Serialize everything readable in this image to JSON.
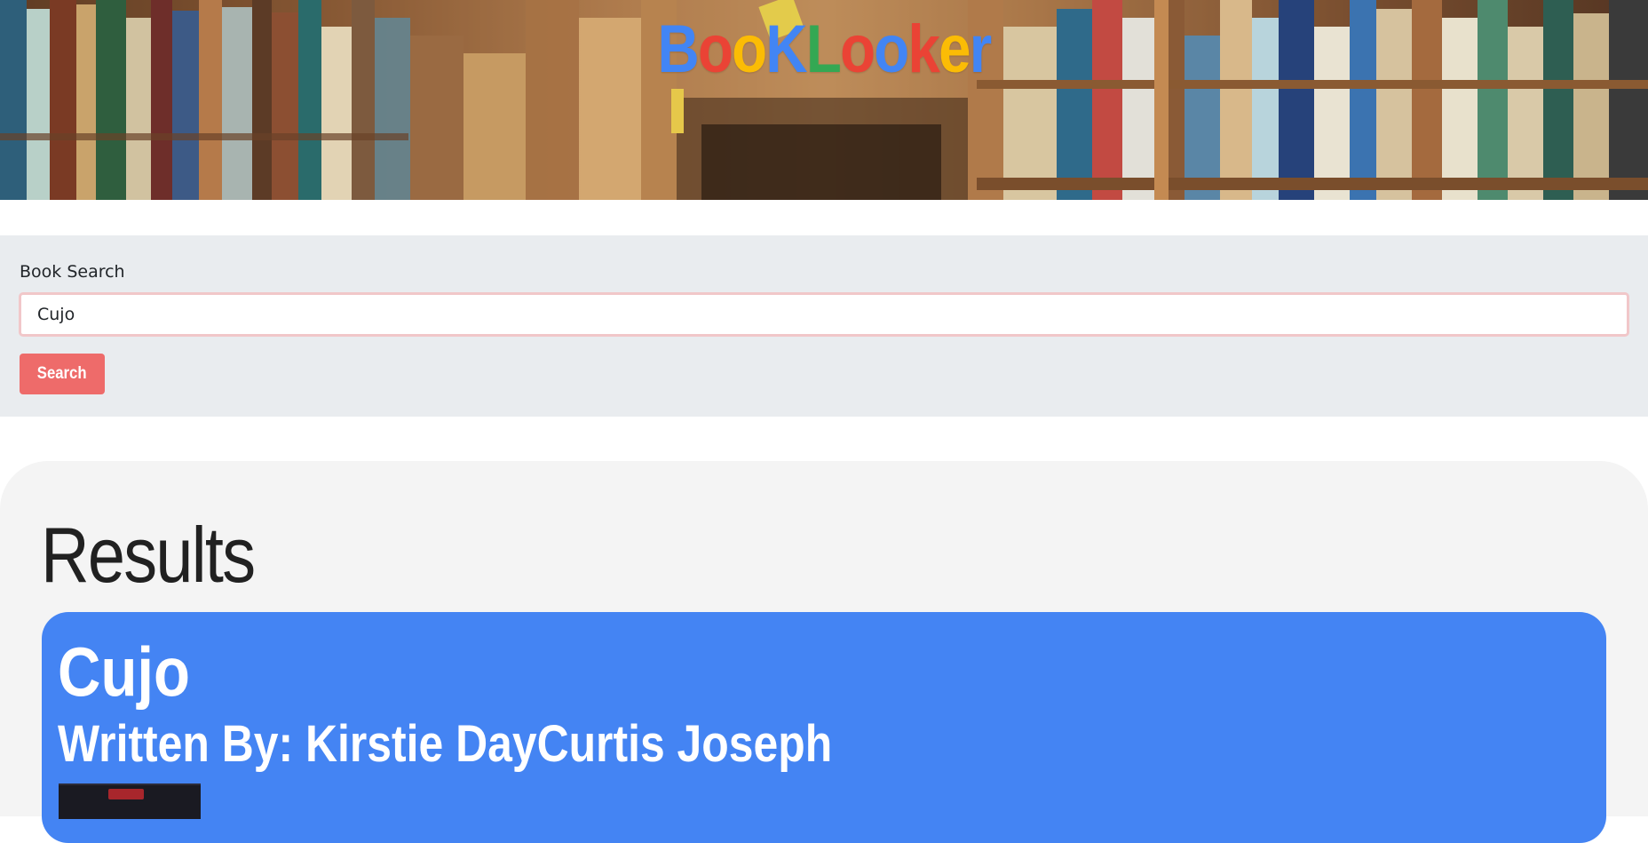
{
  "header": {
    "logo_letters": [
      {
        "char": "B",
        "color": "#4285f4"
      },
      {
        "char": "o",
        "color": "#ea4335"
      },
      {
        "char": "o",
        "color": "#fbbc05"
      },
      {
        "char": "K",
        "color": "#4285f4"
      },
      {
        "char": "L",
        "color": "#34a853"
      },
      {
        "char": "o",
        "color": "#ea4335"
      },
      {
        "char": "o",
        "color": "#4285f4"
      },
      {
        "char": "k",
        "color": "#ea4335"
      },
      {
        "char": "e",
        "color": "#fbbc05"
      },
      {
        "char": "r",
        "color": "#4285f4"
      }
    ]
  },
  "search": {
    "label": "Book Search",
    "value": "Cujo",
    "button_label": "Search",
    "button_color": "#ee6b6a"
  },
  "results": {
    "heading": "Results",
    "items": [
      {
        "title": "Cujo",
        "author_line": "Written By: Kirstie DayCurtis Joseph",
        "card_color": "#4484f3"
      }
    ]
  }
}
